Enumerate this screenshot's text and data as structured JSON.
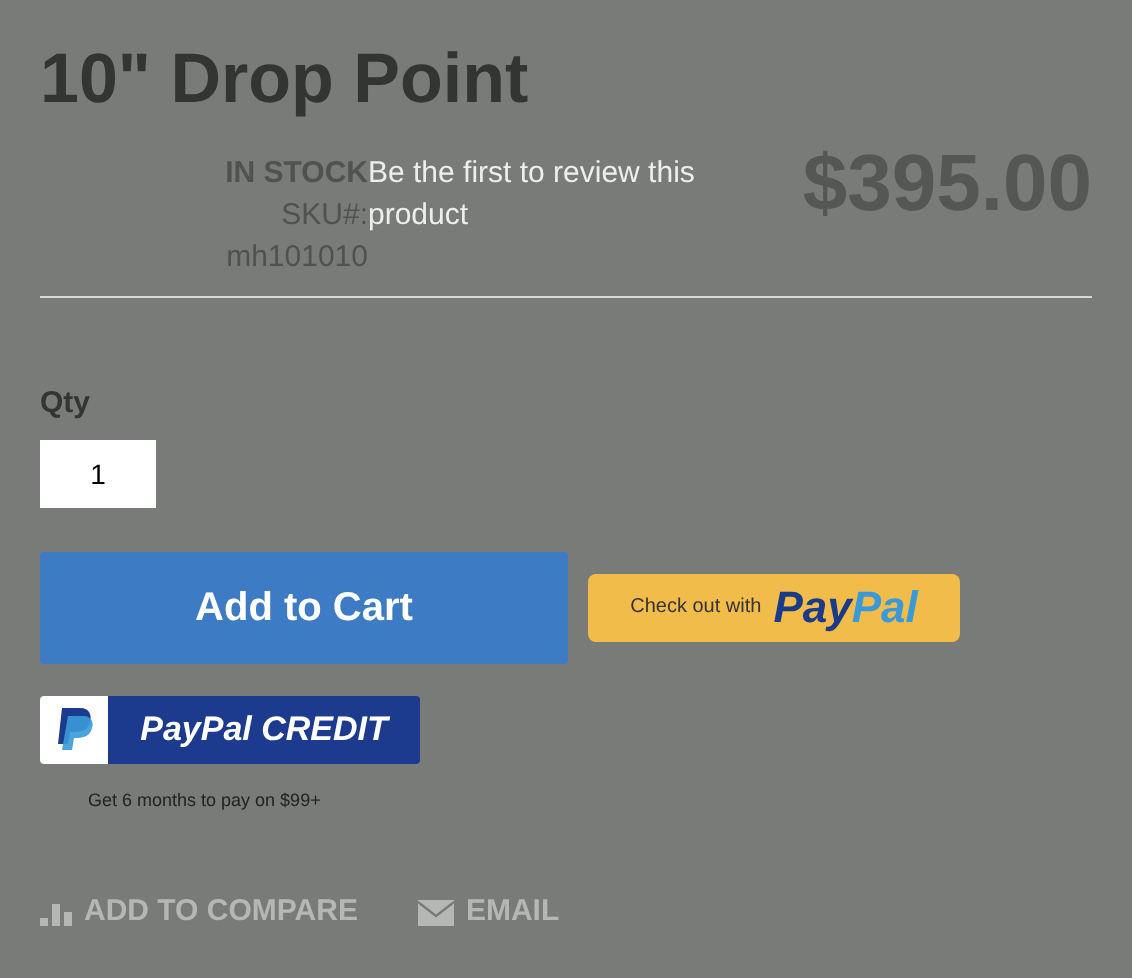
{
  "title": "10\" Drop Point",
  "stock": "IN STOCK",
  "sku_label": "SKU#:",
  "sku": "mh101010",
  "review_link": "Be the first to review this product",
  "price": "$395.00",
  "qty": {
    "label": "Qty",
    "value": "1"
  },
  "add_to_cart": "Add to Cart",
  "paypal_checkout": {
    "prefix": "Check out with",
    "brand_1": "Pay",
    "brand_2": "Pal"
  },
  "paypal_credit": {
    "label": "PayPal CREDIT",
    "note": "Get 6 months to pay on $99+"
  },
  "actions": [
    {
      "kind": "compare",
      "label": "ADD TO COMPARE"
    },
    {
      "kind": "email",
      "label": "EMAIL"
    }
  ]
}
